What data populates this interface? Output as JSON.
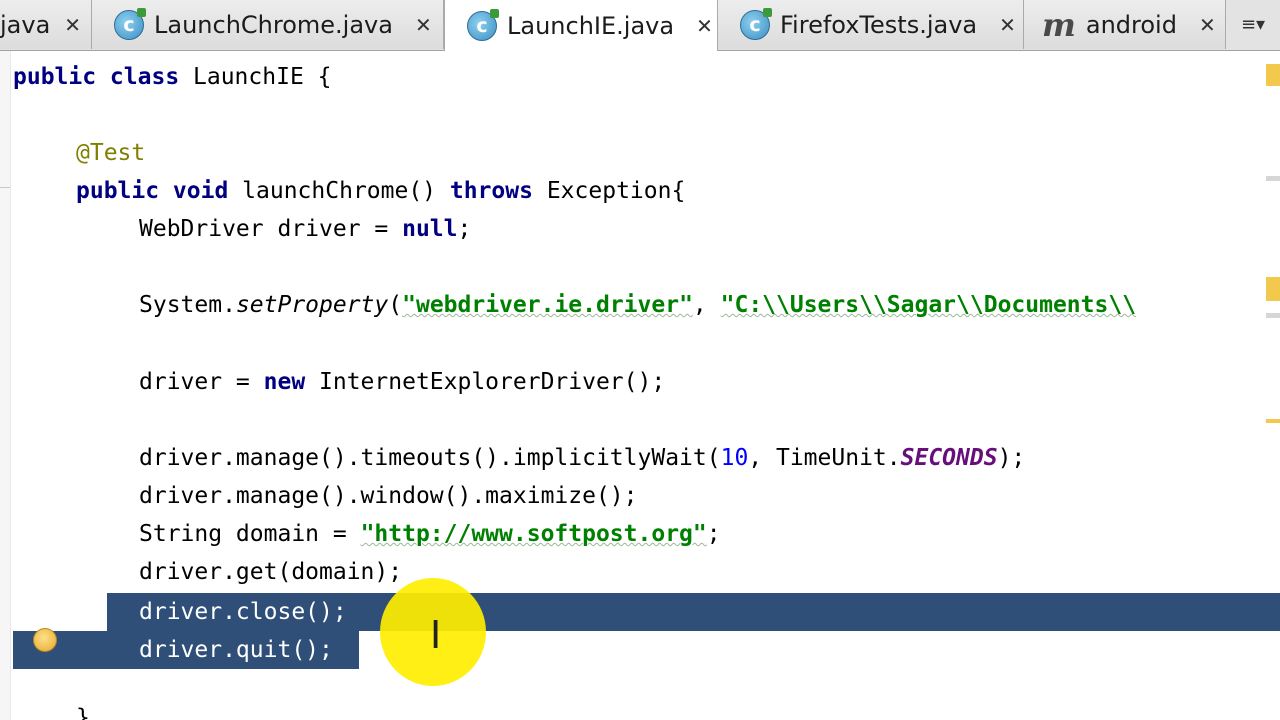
{
  "tabs": [
    {
      "label": "java",
      "icon": "none",
      "active": false
    },
    {
      "label": "LaunchChrome.java",
      "icon": "java-class-icon",
      "active": false
    },
    {
      "label": "LaunchIE.java",
      "icon": "java-class-icon",
      "active": true
    },
    {
      "label": "FirefoxTests.java",
      "icon": "java-class-icon",
      "active": false
    },
    {
      "label": "android",
      "icon": "module-icon",
      "active": false
    }
  ],
  "tab_close_glyph": "✕",
  "tab_more_glyph": "≡▾",
  "code": {
    "l1": {
      "a": "public class ",
      "b": "LaunchIE {"
    },
    "l2": {
      "a": "@Test"
    },
    "l3": {
      "a": "public void ",
      "b": "launchChrome() ",
      "c": "throws ",
      "d": "Exception{"
    },
    "l4": {
      "a": "WebDriver driver = ",
      "b": "null",
      "c": ";"
    },
    "l5": {
      "a": "System.",
      "b": "setProperty",
      "c": "(",
      "d": "\"webdriver.ie.driver\"",
      "e": ", ",
      "f": "\"C:\\\\Users\\\\Sagar\\\\Documents\\\\"
    },
    "l6": {
      "a": "driver = ",
      "b": "new ",
      "c": "InternetExplorerDriver();"
    },
    "l7": {
      "a": "driver.manage().timeouts().implicitlyWait(",
      "b": "10",
      "c": ", TimeUnit.",
      "d": "SECONDS",
      "e": ");"
    },
    "l8": {
      "a": "driver.manage().window().maximize();"
    },
    "l9": {
      "a": "String domain = ",
      "b": "\"http://www.softpost.org\"",
      "c": ";"
    },
    "l10": {
      "a": "driver.get(domain);"
    },
    "l11": {
      "a": "driver.close();"
    },
    "l12": {
      "a": "driver.quit();"
    },
    "l13": {
      "a": "}"
    }
  },
  "colors": {
    "keyword": "#000080",
    "string": "#008000",
    "annotation": "#808000",
    "number": "#0000ff",
    "constant": "#660e7a",
    "selection": "#2f4f78",
    "cursor_highlight": "#ffee00"
  }
}
